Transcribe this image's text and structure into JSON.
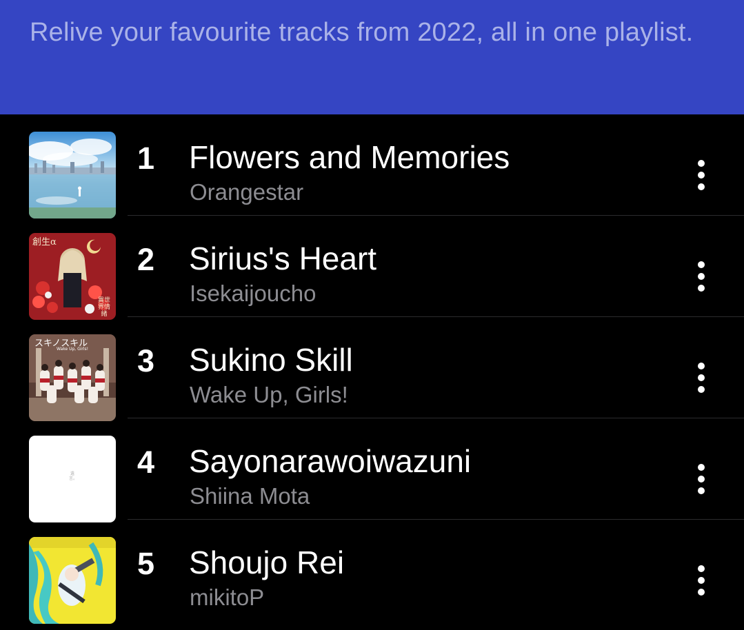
{
  "header": {
    "description": "Relive your favourite tracks from 2022, all in one playlist."
  },
  "tracks": [
    {
      "number": "1",
      "title": "Flowers and Memories",
      "artist": "Orangestar",
      "art": "sky-city-art-icon"
    },
    {
      "number": "2",
      "title": "Sirius's Heart",
      "artist": "Isekaijoucho",
      "art": "red-flowers-art-icon"
    },
    {
      "number": "3",
      "title": "Sukino Skill",
      "artist": "Wake Up, Girls!",
      "art": "group-stage-art-icon"
    },
    {
      "number": "4",
      "title": "Sayonarawoiwazuni",
      "artist": "Shiina Mota",
      "art": "white-minimal-art-icon"
    },
    {
      "number": "5",
      "title": "Shoujo Rei",
      "artist": "mikitoP",
      "art": "yellow-anime-art-icon"
    }
  ],
  "art_text": {
    "track2_logo": "創生α",
    "track2_corner": "異世界情緒",
    "track3_logo": "スキノスキル",
    "track3_sub": "Wake Up, Girls!",
    "track4_mark": "遺言。"
  },
  "colors": {
    "header_bg": "#3545c3",
    "header_text": "#aab2e8",
    "background": "#000000",
    "title_text": "#ffffff",
    "artist_text": "#8d8d92",
    "divider": "#2c2c2e"
  }
}
